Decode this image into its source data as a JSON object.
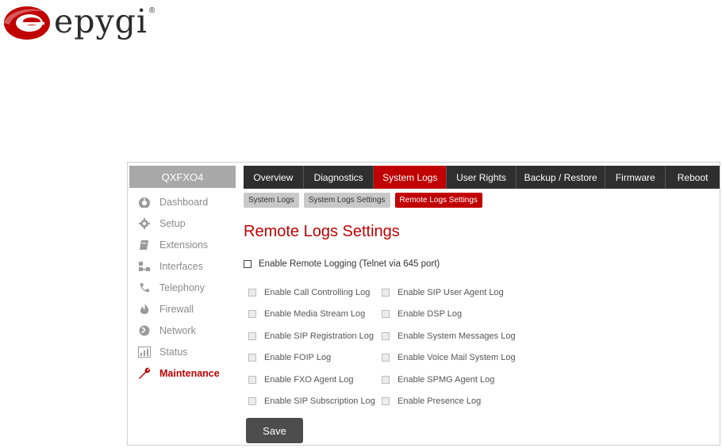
{
  "logo": {
    "text": "epygi",
    "reg": "®",
    "brand_color": "#c00000"
  },
  "device_name": "QXFXO4",
  "sidebar": {
    "items": [
      {
        "label": "Dashboard",
        "icon": "dashboard-icon"
      },
      {
        "label": "Setup",
        "icon": "gear-icon"
      },
      {
        "label": "Extensions",
        "icon": "book-icon"
      },
      {
        "label": "Interfaces",
        "icon": "network-nodes-icon"
      },
      {
        "label": "Telephony",
        "icon": "phone-icon"
      },
      {
        "label": "Firewall",
        "icon": "flame-icon"
      },
      {
        "label": "Network",
        "icon": "globe-icon"
      },
      {
        "label": "Status",
        "icon": "bar-chart-icon"
      },
      {
        "label": "Maintenance",
        "icon": "wrench-icon",
        "active": true
      }
    ]
  },
  "tabs": [
    {
      "label": "Overview"
    },
    {
      "label": "Diagnostics"
    },
    {
      "label": "System Logs",
      "active": true
    },
    {
      "label": "User Rights"
    },
    {
      "label": "Backup / Restore"
    },
    {
      "label": "Firmware"
    },
    {
      "label": "Reboot"
    }
  ],
  "subtabs": [
    {
      "label": "System Logs"
    },
    {
      "label": "System Logs Settings"
    },
    {
      "label": "Remote Logs Settings",
      "active": true
    }
  ],
  "page_title": "Remote Logs Settings",
  "master_checkbox": {
    "label": "Enable Remote Logging (Telnet via 645 port)",
    "checked": false
  },
  "options": {
    "col1": [
      "Enable Call Controlling Log",
      "Enable Media Stream Log",
      "Enable SIP Registration Log",
      "Enable FOIP Log",
      "Enable FXO Agent Log",
      "Enable SIP Subscription Log"
    ],
    "col2": [
      "Enable SIP User Agent Log",
      "Enable DSP Log",
      "Enable System Messages Log",
      "Enable Voice Mail System Log",
      "Enable SPMG Agent Log",
      "Enable Presence Log"
    ]
  },
  "save_label": "Save"
}
